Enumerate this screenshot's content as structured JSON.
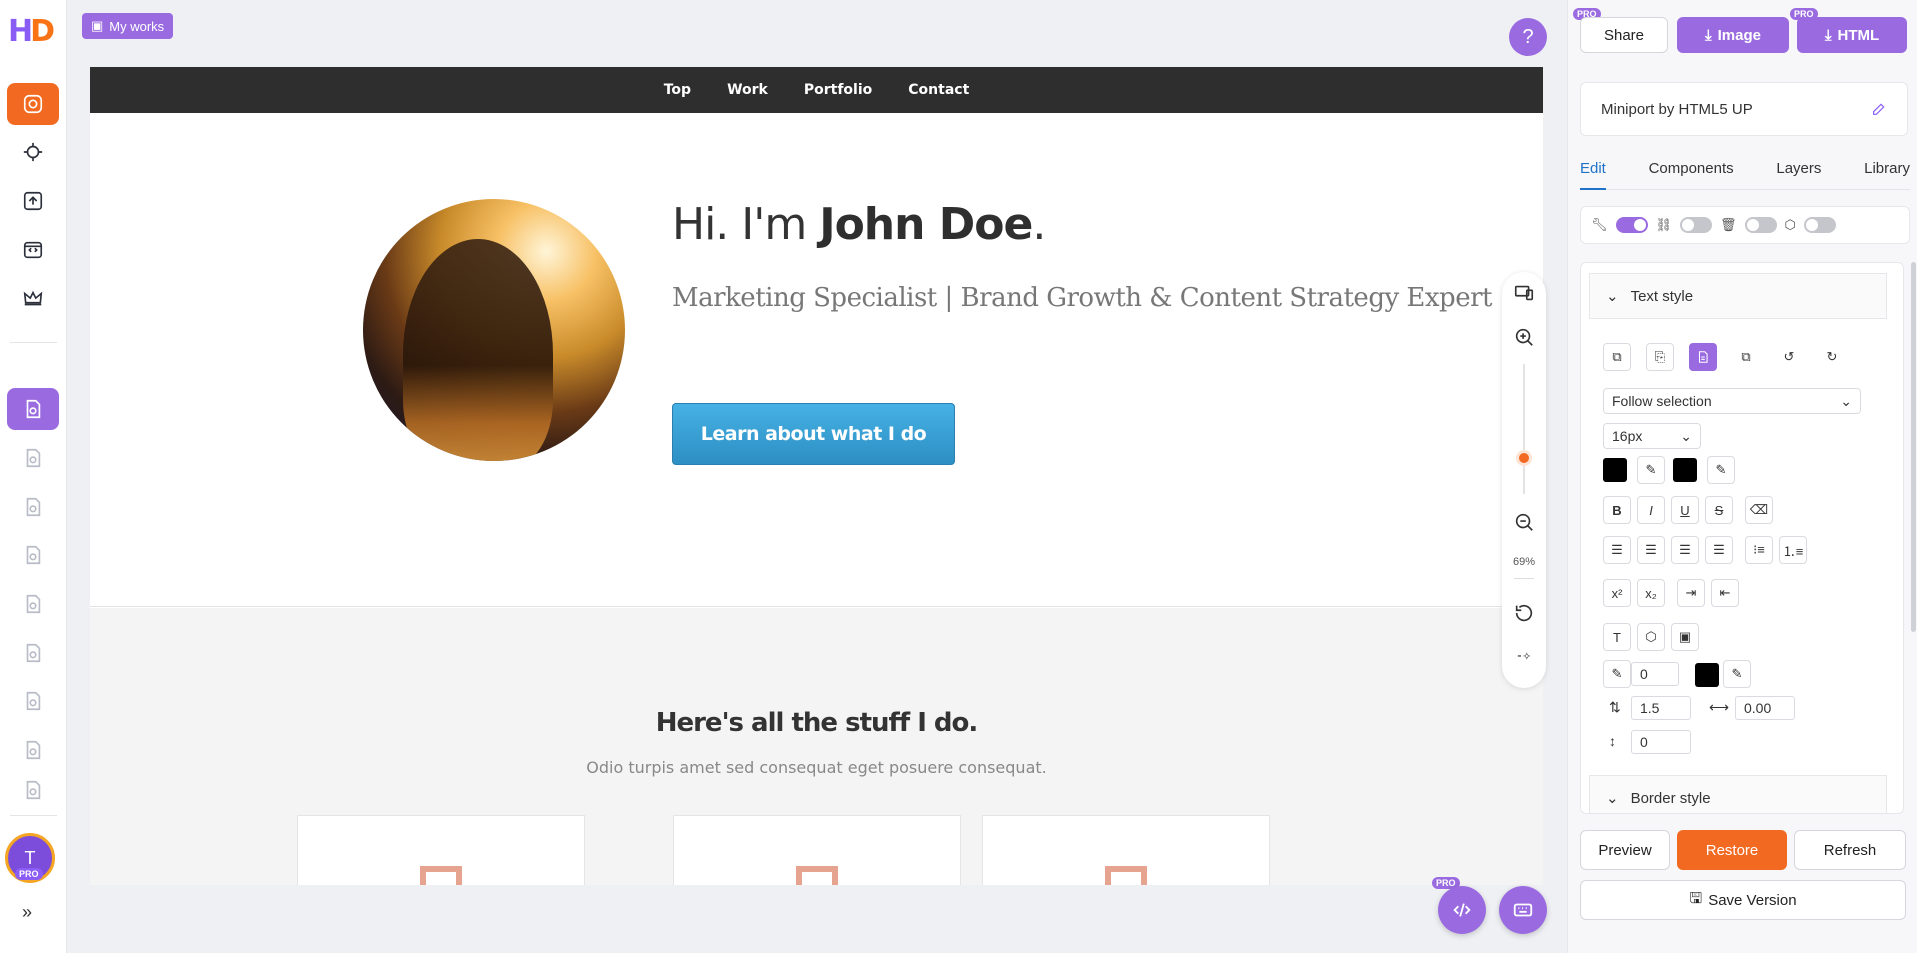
{
  "rail": {
    "logo": {
      "letters": "HD",
      "accent": "#f97316"
    },
    "items": [
      {
        "icon": "screenshot-icon"
      },
      {
        "icon": "target-icon"
      },
      {
        "icon": "upload-icon"
      },
      {
        "icon": "code-file-icon"
      },
      {
        "icon": "crown-icon"
      },
      {
        "icon": "page-icon"
      }
    ],
    "avatar_initial": "T",
    "avatar_badge": "PRO"
  },
  "canvas": {
    "my_works_label": "My works",
    "help_icon": "question-icon",
    "zoom_level": "69%"
  },
  "site": {
    "nav": [
      "Top",
      "Work",
      "Portfolio",
      "Contact"
    ],
    "hero_greeting": "Hi. I'm ",
    "hero_name": "John Doe",
    "hero_period": ".",
    "hero_subtitle": "Marketing Specialist | Brand Growth & Content Strategy Expert",
    "cta_label": "Learn about what I do",
    "section_title": "Here's all the stuff I do.",
    "section_text": "Odio turpis amet sed consequat eget posuere consequat."
  },
  "panel": {
    "share_label": "Share",
    "image_label": "Image",
    "html_label": "HTML",
    "pro_tag": "PRO",
    "project_name": "Miniport by HTML5 UP",
    "tabs": [
      "Edit",
      "Components",
      "Layers",
      "Library"
    ],
    "active_tab": "Edit",
    "text_style_label": "Text style",
    "border_style_label": "Border style",
    "font_select": "Follow selection",
    "font_size": "16px",
    "stroke_width": "0",
    "line_height": "1.5",
    "letter_spacing": "0.00",
    "paragraph_spacing": "0",
    "preview_label": "Preview",
    "restore_label": "Restore",
    "refresh_label": "Refresh",
    "save_label": "Save Version",
    "colors": {
      "accent": "#9a6be0",
      "restore": "#f26a21",
      "active_tab": "#1e73c8"
    }
  }
}
